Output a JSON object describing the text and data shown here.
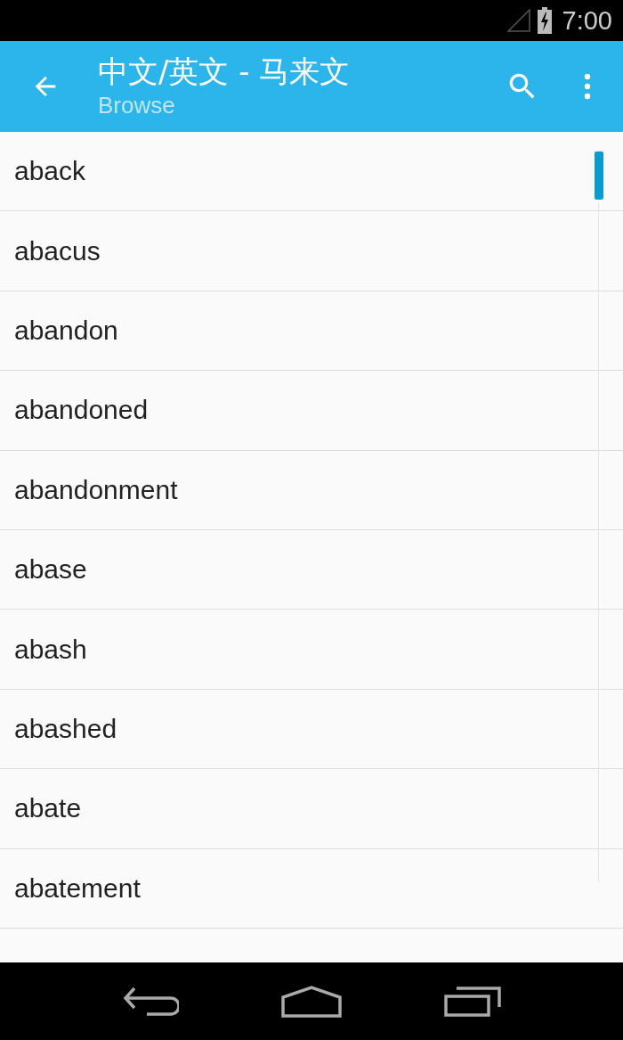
{
  "status_bar": {
    "time": "7:00"
  },
  "app_bar": {
    "title": "中文/英文 - 马来文",
    "subtitle": "Browse"
  },
  "words": [
    "aback",
    "abacus",
    "abandon",
    "abandoned",
    "abandonment",
    "abase",
    "abash",
    "abashed",
    "abate",
    "abatement"
  ]
}
